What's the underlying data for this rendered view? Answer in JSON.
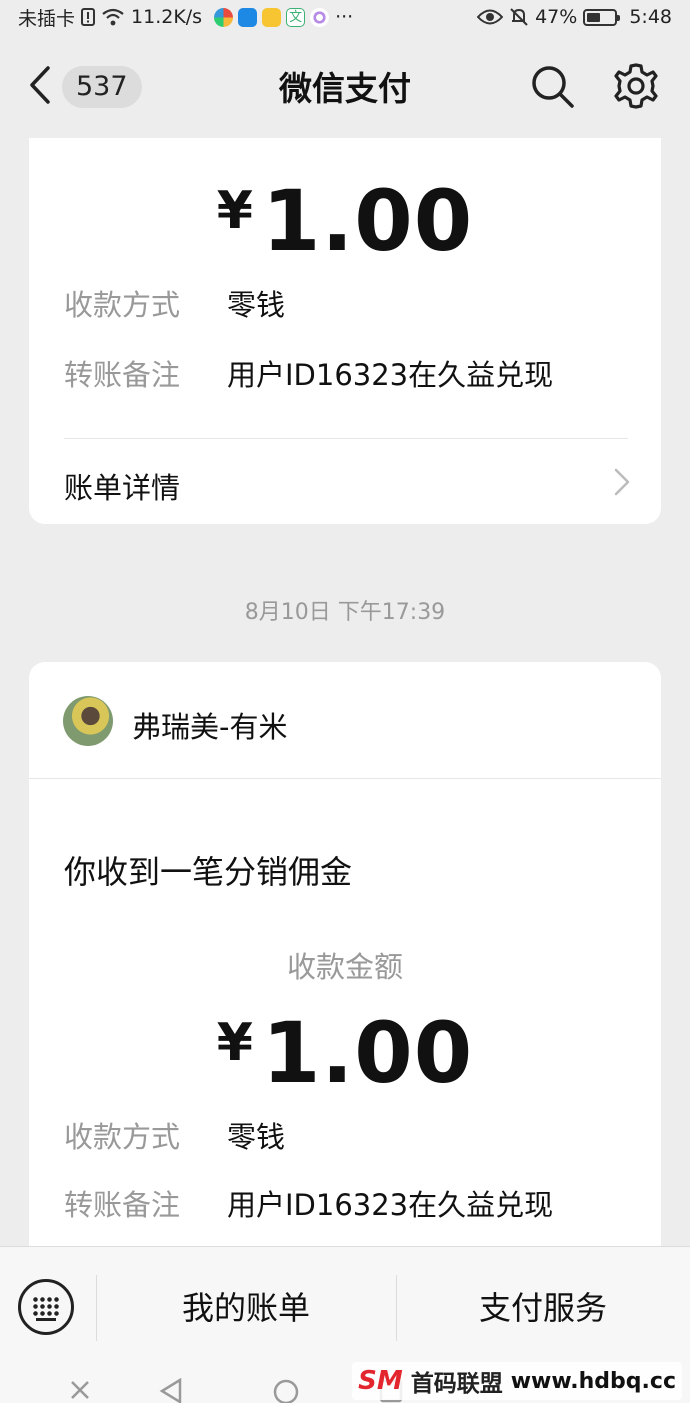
{
  "status_bar": {
    "carrier": "未插卡",
    "speed": "11.2K/s",
    "more": "···",
    "battery": "47%",
    "time": "5:48"
  },
  "header": {
    "badge": "537",
    "title": "微信支付"
  },
  "card1": {
    "amount": "1.00",
    "currency": "¥",
    "method_label": "收款方式",
    "method_value": "零钱",
    "note_label": "转账备注",
    "note_value": "用户ID16323在久益兑现",
    "details_label": "账单详情"
  },
  "timestamp": "8月10日 下午17:39",
  "card2": {
    "sender_name": "弗瑞美-有米",
    "message_title": "你收到一笔分销佣金",
    "amount_label": "收款金额",
    "currency": "¥",
    "amount": "1.00",
    "method_label": "收款方式",
    "method_value": "零钱",
    "note_label": "转账备注",
    "note_value": "用户ID16323在久益兑现"
  },
  "bottom_bar": {
    "my_bills": "我的账单",
    "pay_services": "支付服务"
  },
  "watermark": {
    "logo": "SM",
    "name": "首码联盟",
    "url": "www.hdbq.cc"
  },
  "icons": {
    "back": "chevron-left-icon",
    "search": "search-icon",
    "settings": "gear-icon",
    "keyboard": "keyboard-icon"
  }
}
